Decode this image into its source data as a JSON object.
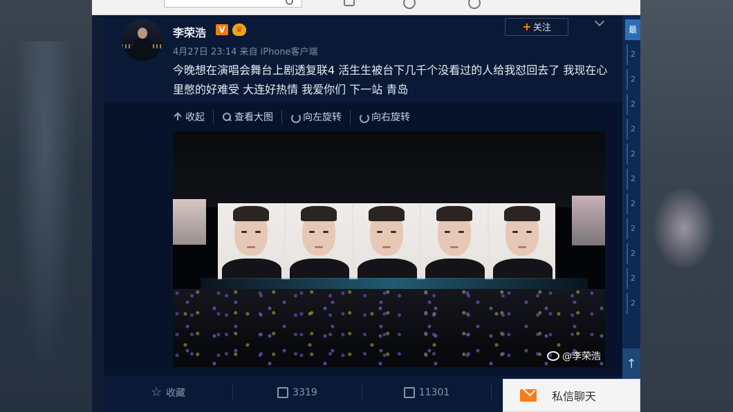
{
  "post": {
    "author_name": "李荣浩",
    "verified_badge": "V",
    "crown_badge": "♛",
    "follow_label": "关注",
    "follow_plus": "+",
    "meta": "4月27日 23:14 来自 iPhone客户端",
    "text": "今晚想在演唱会舞台上剧透复联4 活生生被台下几千个没看过的人给我怼回去了 我现在心里憋的好难受 大连好热情 我爱你们 下一站 青岛"
  },
  "image_tools": [
    {
      "label": "收起",
      "icon": "collapse-up-icon"
    },
    {
      "label": "查看大图",
      "icon": "zoom-icon"
    },
    {
      "label": "向左旋转",
      "icon": "rotate-left-icon"
    },
    {
      "label": "向右旋转",
      "icon": "rotate-right-icon"
    }
  ],
  "photo": {
    "watermark": "@李荣浩"
  },
  "actions": [
    {
      "label": "收藏",
      "icon": "star-icon"
    },
    {
      "label": "3319",
      "icon": "share-icon"
    },
    {
      "label": "11301",
      "icon": "comment-icon"
    },
    {
      "label": "",
      "icon": "like-icon"
    }
  ],
  "timeline": {
    "head": "最",
    "items": [
      "2",
      "2",
      "2",
      "2",
      "2",
      "2",
      "2",
      "2",
      "2",
      "2",
      "2"
    ],
    "foot": "↑"
  },
  "chat": {
    "label": "私信聊天"
  },
  "colors": {
    "accent_orange": "#ff8200",
    "card_bg": "#0a1a36",
    "timeline_blue": "#2e6db8"
  }
}
